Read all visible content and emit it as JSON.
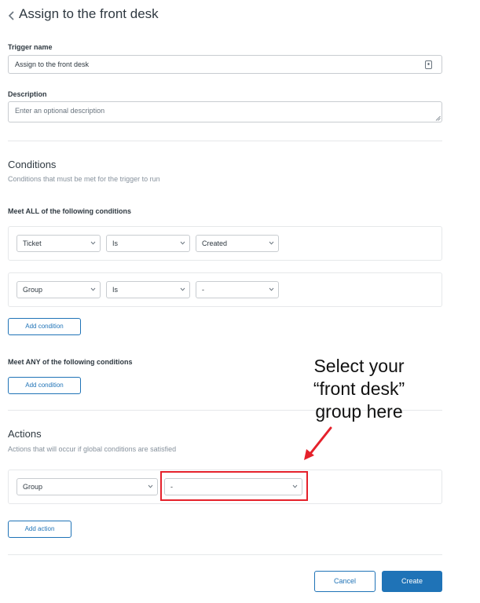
{
  "header": {
    "title": "Assign to the front desk"
  },
  "form": {
    "trigger_name_label": "Trigger name",
    "trigger_name_value": "Assign to the front desk",
    "description_label": "Description",
    "description_placeholder": "Enter an optional description"
  },
  "conditions": {
    "title": "Conditions",
    "description": "Conditions that must be met for the trigger to run",
    "all_label": "Meet ALL of the following conditions",
    "all_rows": [
      {
        "field": "Ticket",
        "operator": "Is",
        "value": "Created"
      },
      {
        "field": "Group",
        "operator": "Is",
        "value": "-"
      }
    ],
    "add_condition_label": "Add condition",
    "any_label": "Meet ANY of the following conditions"
  },
  "actions": {
    "title": "Actions",
    "description": "Actions that will occur if global conditions are satisfied",
    "rows": [
      {
        "field": "Group",
        "value": "-"
      }
    ],
    "add_action_label": "Add action"
  },
  "footer": {
    "cancel_label": "Cancel",
    "create_label": "Create"
  },
  "annotation": {
    "text": "Select your “front desk” group here",
    "color": "#e5212b"
  },
  "colors": {
    "accent": "#1f73b7",
    "annotation_red": "#e5212b"
  }
}
